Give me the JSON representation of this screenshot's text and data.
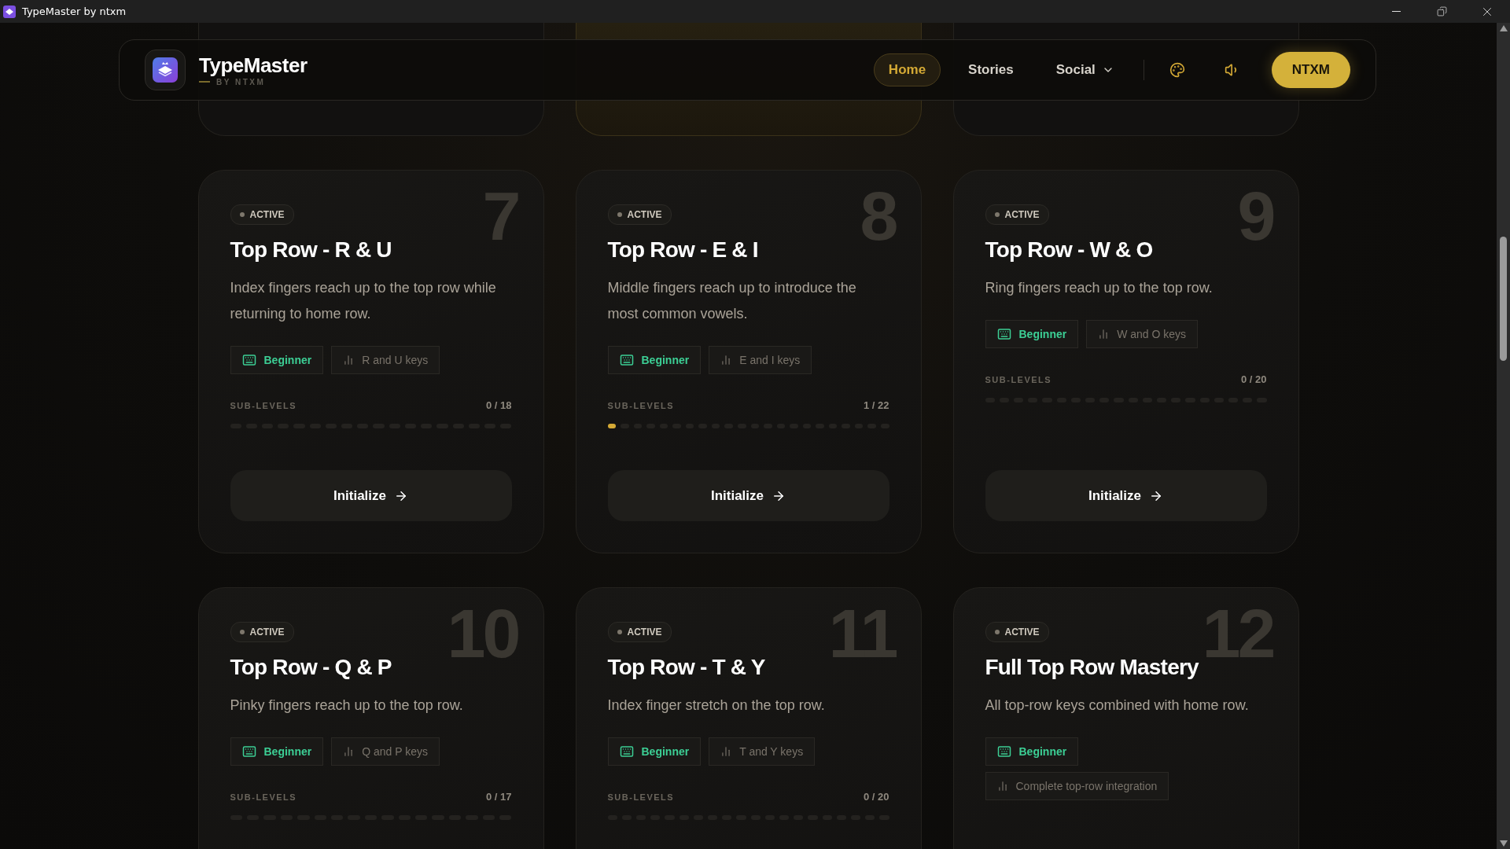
{
  "window": {
    "title": "TypeMaster by ntxm"
  },
  "nav": {
    "brand": "TypeMaster",
    "byline": "BY NTXM",
    "links": [
      {
        "label": "Home",
        "selected": true,
        "kind": "link"
      },
      {
        "label": "Stories",
        "selected": false,
        "kind": "link"
      },
      {
        "label": "Social",
        "selected": false,
        "kind": "dropdown"
      }
    ],
    "account_button": "NTXM"
  },
  "top_stubs": [
    {
      "highlighted": false
    },
    {
      "highlighted": true
    },
    {
      "highlighted": false
    }
  ],
  "lessons": [
    {
      "number": "7",
      "status": "ACTIVE",
      "title": "Top Row - R & U",
      "description": "Index fingers reach up to the top row while returning to home row.",
      "tags": [
        {
          "kind": "difficulty",
          "label": "Beginner"
        },
        {
          "kind": "keys",
          "label": "R and U keys"
        }
      ],
      "sub_levels_label": "SUB-LEVELS",
      "progress": "0 / 18",
      "button": "Initialize",
      "dots": [
        {
          "filled": false
        },
        {
          "filled": false
        },
        {
          "filled": false
        },
        {
          "filled": false
        },
        {
          "filled": false
        },
        {
          "filled": false
        },
        {
          "filled": false
        },
        {
          "filled": false
        },
        {
          "filled": false
        },
        {
          "filled": false
        },
        {
          "filled": false
        },
        {
          "filled": false
        },
        {
          "filled": false
        },
        {
          "filled": false
        },
        {
          "filled": false
        },
        {
          "filled": false
        },
        {
          "filled": false
        },
        {
          "filled": false
        }
      ]
    },
    {
      "number": "8",
      "status": "ACTIVE",
      "title": "Top Row - E & I",
      "description": "Middle fingers reach up to introduce the most common vowels.",
      "tags": [
        {
          "kind": "difficulty",
          "label": "Beginner"
        },
        {
          "kind": "keys",
          "label": "E and I keys"
        }
      ],
      "sub_levels_label": "SUB-LEVELS",
      "progress": "1 / 22",
      "button": "Initialize",
      "dots": [
        {
          "filled": true
        },
        {
          "filled": false
        },
        {
          "filled": false
        },
        {
          "filled": false
        },
        {
          "filled": false
        },
        {
          "filled": false
        },
        {
          "filled": false
        },
        {
          "filled": false
        },
        {
          "filled": false
        },
        {
          "filled": false
        },
        {
          "filled": false
        },
        {
          "filled": false
        },
        {
          "filled": false
        },
        {
          "filled": false
        },
        {
          "filled": false
        },
        {
          "filled": false
        },
        {
          "filled": false
        },
        {
          "filled": false
        },
        {
          "filled": false
        },
        {
          "filled": false
        },
        {
          "filled": false
        },
        {
          "filled": false
        }
      ]
    },
    {
      "number": "9",
      "status": "ACTIVE",
      "title": "Top Row - W & O",
      "description": "Ring fingers reach up to the top row.",
      "tags": [
        {
          "kind": "difficulty",
          "label": "Beginner"
        },
        {
          "kind": "keys",
          "label": "W and O keys"
        }
      ],
      "sub_levels_label": "SUB-LEVELS",
      "progress": "0 / 20",
      "button": "Initialize",
      "dots": [
        {
          "filled": false
        },
        {
          "filled": false
        },
        {
          "filled": false
        },
        {
          "filled": false
        },
        {
          "filled": false
        },
        {
          "filled": false
        },
        {
          "filled": false
        },
        {
          "filled": false
        },
        {
          "filled": false
        },
        {
          "filled": false
        },
        {
          "filled": false
        },
        {
          "filled": false
        },
        {
          "filled": false
        },
        {
          "filled": false
        },
        {
          "filled": false
        },
        {
          "filled": false
        },
        {
          "filled": false
        },
        {
          "filled": false
        },
        {
          "filled": false
        },
        {
          "filled": false
        }
      ]
    },
    {
      "number": "10",
      "status": "ACTIVE",
      "title": "Top Row - Q & P",
      "description": "Pinky fingers reach up to the top row.",
      "tags": [
        {
          "kind": "difficulty",
          "label": "Beginner"
        },
        {
          "kind": "keys",
          "label": "Q and P keys"
        }
      ],
      "sub_levels_label": "SUB-LEVELS",
      "progress": "0 / 17",
      "dots": [
        {
          "filled": false
        },
        {
          "filled": false
        },
        {
          "filled": false
        },
        {
          "filled": false
        },
        {
          "filled": false
        },
        {
          "filled": false
        },
        {
          "filled": false
        },
        {
          "filled": false
        },
        {
          "filled": false
        },
        {
          "filled": false
        },
        {
          "filled": false
        },
        {
          "filled": false
        },
        {
          "filled": false
        },
        {
          "filled": false
        },
        {
          "filled": false
        },
        {
          "filled": false
        },
        {
          "filled": false
        }
      ]
    },
    {
      "number": "11",
      "status": "ACTIVE",
      "title": "Top Row - T & Y",
      "description": "Index finger stretch on the top row.",
      "tags": [
        {
          "kind": "difficulty",
          "label": "Beginner"
        },
        {
          "kind": "keys",
          "label": "T and Y keys"
        }
      ],
      "sub_levels_label": "SUB-LEVELS",
      "progress": "0 / 20",
      "dots": [
        {
          "filled": false
        },
        {
          "filled": false
        },
        {
          "filled": false
        },
        {
          "filled": false
        },
        {
          "filled": false
        },
        {
          "filled": false
        },
        {
          "filled": false
        },
        {
          "filled": false
        },
        {
          "filled": false
        },
        {
          "filled": false
        },
        {
          "filled": false
        },
        {
          "filled": false
        },
        {
          "filled": false
        },
        {
          "filled": false
        },
        {
          "filled": false
        },
        {
          "filled": false
        },
        {
          "filled": false
        },
        {
          "filled": false
        },
        {
          "filled": false
        },
        {
          "filled": false
        }
      ]
    },
    {
      "number": "12",
      "status": "ACTIVE",
      "title": "Full Top Row Mastery",
      "description": "All top-row keys combined with home row.",
      "tags": [
        {
          "kind": "difficulty",
          "label": "Beginner"
        },
        {
          "kind": "keys",
          "label": "Complete top-row integration"
        }
      ]
    }
  ]
}
